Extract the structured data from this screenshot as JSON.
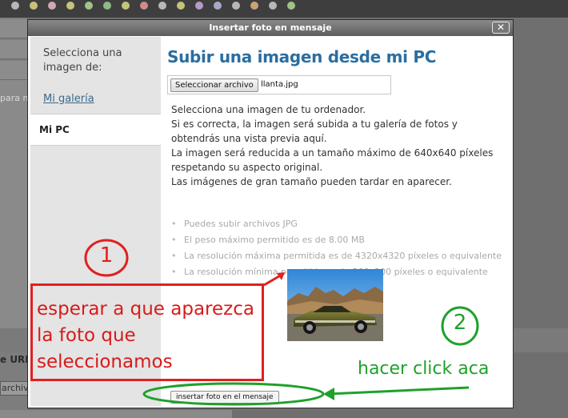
{
  "dialog": {
    "title": "Insertar foto en mensaje",
    "close_label": "✕"
  },
  "sidebar": {
    "heading": "Selecciona una imagen de:",
    "items": [
      {
        "label": "Mi galería",
        "active": false
      },
      {
        "label": "Mi PC",
        "active": true
      }
    ]
  },
  "main": {
    "heading": "Subir una imagen desde mi PC",
    "file_button": "Seleccionar archivo",
    "file_name": "llanta.jpg",
    "description_lines": [
      "Selecciona una imagen de tu ordenador.",
      "Si es correcta, la imagen será subida a tu galería de fotos y",
      "obtendrás una vista previa aquí.",
      "La imagen será reducida a un tamaño máximo de 640x640 píxeles",
      "respetando su aspecto original.",
      "Las imágenes de gran tamaño pueden tardar en aparecer."
    ],
    "rules": [
      "Puedes subir archivos JPG",
      "El peso máximo permitido es de 8.00 MB",
      "La resolución máxima permitida es de 4320x4320 píxeles o equivalente",
      "La resolución mínima permitida es de 200x200 píxeles o equivalente"
    ],
    "submit_button": "insertar foto en el mensaje"
  },
  "background": {
    "snippet": "para m",
    "url_label": "e URL",
    "input_value": "archivo"
  },
  "annotations": {
    "step1_number": "1",
    "step1_lines": [
      "esperar a que aparezca",
      "la foto que",
      "seleccionamos"
    ],
    "step2_number": "2",
    "step2_text": "hacer click aca",
    "colors": {
      "red": "#e02020",
      "green": "#1fa12b"
    }
  },
  "colors": {
    "heading": "#2a6ea0",
    "link": "#3b6a8c",
    "sidebar_bg": "#e4e4e4",
    "titlebar": "#6e6e6e"
  }
}
